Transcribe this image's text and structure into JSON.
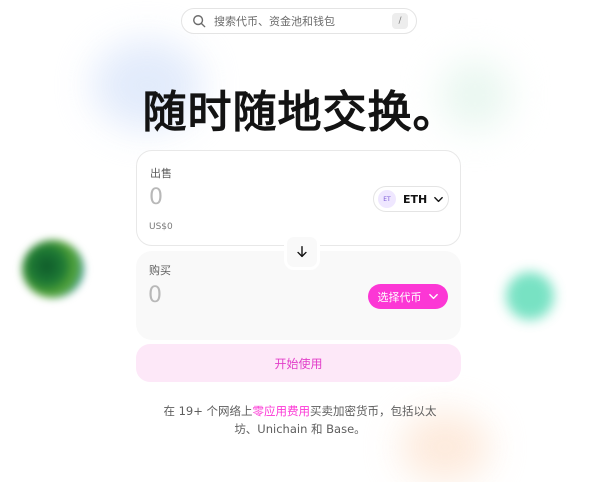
{
  "search": {
    "placeholder": "搜索代币、资金池和钱包",
    "shortcut": "/"
  },
  "hero": {
    "title": "随时随地交换。"
  },
  "sell": {
    "label": "出售",
    "amount": "0",
    "usd_value": "US$0",
    "token": {
      "logo_text": "ET",
      "symbol": "ETH"
    }
  },
  "buy": {
    "label": "购买",
    "amount": "0",
    "select_label": "选择代币"
  },
  "cta": {
    "label": "开始使用"
  },
  "footer": {
    "text_before": "在 19+ 个网络上",
    "link": "零应用费用",
    "text_after": "买卖加密货币，包括以太",
    "line2": "坊、Unichain 和 Base。"
  },
  "colors": {
    "accent": "#fc37d5",
    "cta_bg": "#fde8f8",
    "cta_text": "#e23ec9",
    "text_primary": "#131313",
    "text_secondary": "#5e5e5e"
  },
  "icons": {
    "search": "search-icon",
    "token_chevron": "chevron-down-icon",
    "swap": "arrow-down-icon"
  }
}
